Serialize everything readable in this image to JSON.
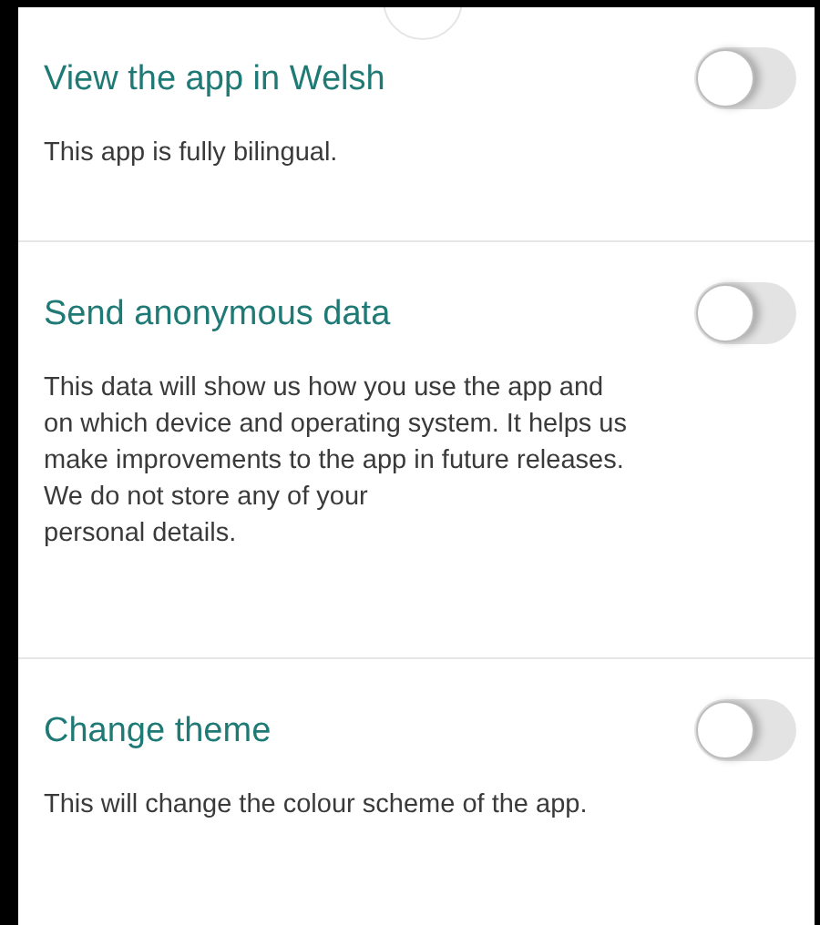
{
  "settings": [
    {
      "title": "View the app in Welsh",
      "description": "This app is fully bilingual.",
      "on": false
    },
    {
      "title": "Send anonymous data",
      "description": "This data will show us how you use the app and on which device and operating system. It helps us make improvements to the app in future releases.\nWe do not store any of your\npersonal details.",
      "on": false
    },
    {
      "title": "Change theme",
      "description": "This will change the colour scheme of the app.",
      "on": false
    }
  ]
}
